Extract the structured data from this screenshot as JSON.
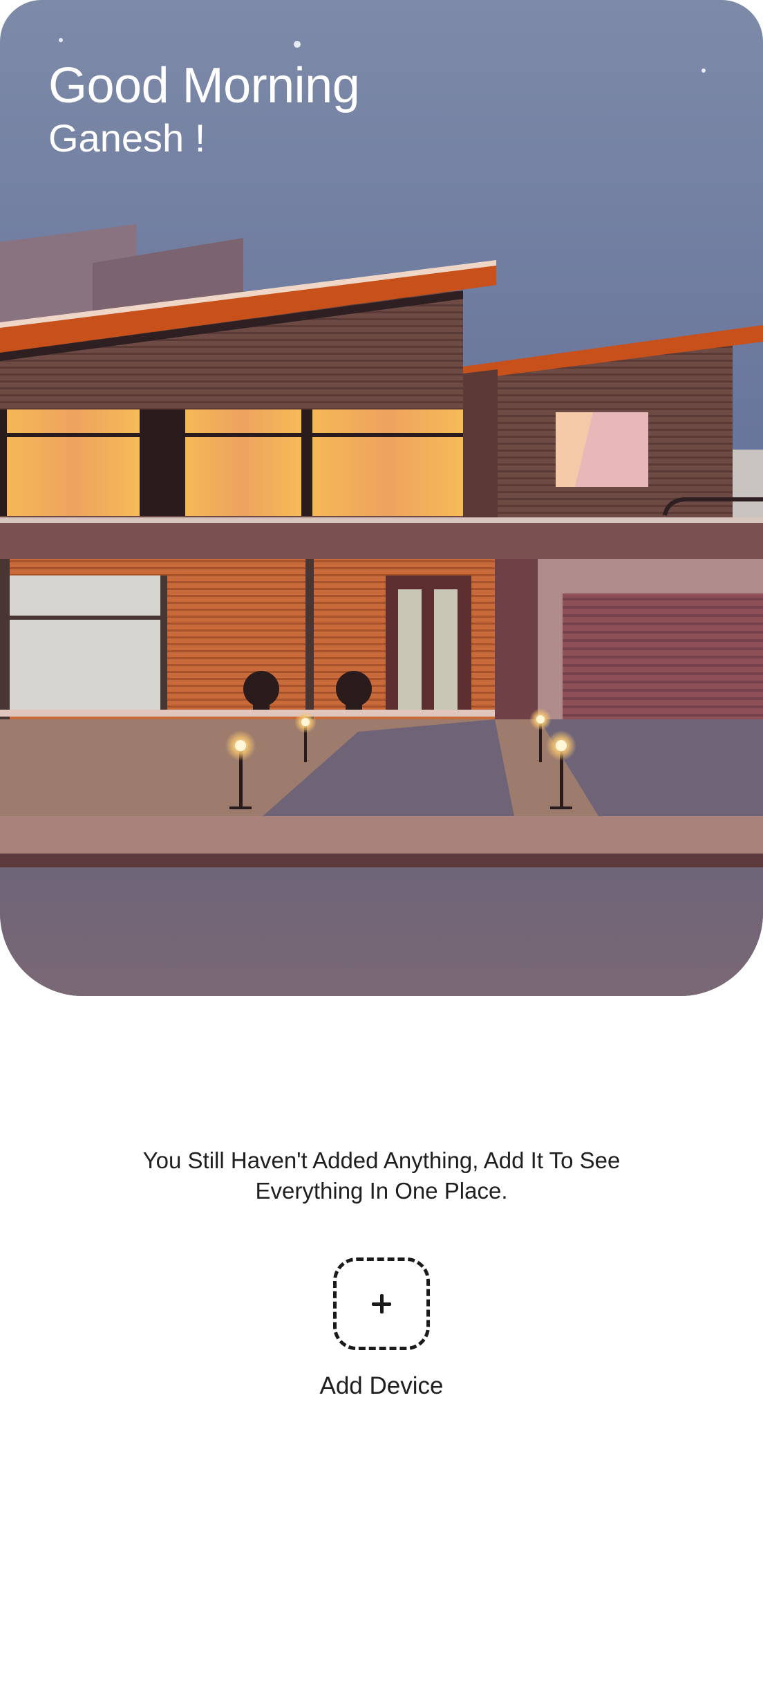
{
  "header": {
    "greeting": "Good Morning",
    "user_name": "Ganesh !"
  },
  "hero": {
    "illustration": "modern-house-evening-illustration"
  },
  "empty_state": {
    "message": "You Still Haven't Added Anything, Add It To See Everything In One Place."
  },
  "add_device": {
    "icon": "plus-icon",
    "label": "Add Device"
  },
  "colors": {
    "sky_top": "#5f6b8f",
    "roof_accent": "#c8501a",
    "window_glow": "#f6b955",
    "text_dark": "#1f1f1f"
  }
}
